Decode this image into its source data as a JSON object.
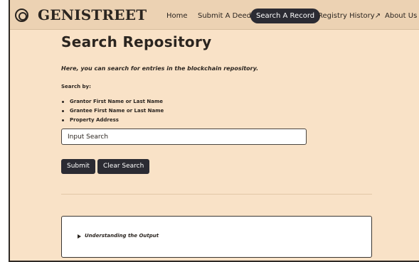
{
  "brand": {
    "name": "GENISTREET",
    "logo_icon": "concentric-circle-logo"
  },
  "nav": {
    "items": [
      {
        "label": "Home",
        "active": false
      },
      {
        "label": "Submit A Deed",
        "active": false
      },
      {
        "label": "Search A Record",
        "active": true
      },
      {
        "label": "Registry History",
        "active": false,
        "icon": "external-arrow-icon"
      },
      {
        "label": "About Us",
        "active": false
      }
    ],
    "external_arrow": "↗"
  },
  "page": {
    "title": "Search Repository",
    "intro": "Here, you can search for entries in the blockchain repository.",
    "search_by_label": "Search by:",
    "search_options": [
      "Grantor First Name or Last Name",
      "Grantee First Name or Last Name",
      "Property Address"
    ]
  },
  "search": {
    "value": "Input Search",
    "placeholder": "Input Search"
  },
  "buttons": {
    "submit": "Submit",
    "clear": "Clear Search"
  },
  "output": {
    "summary": "Understanding the Output"
  },
  "colors": {
    "page_background": "#f9e2c7",
    "navbar_background": "#ecd2b3",
    "dark_accent": "#2b2b33",
    "text": "#2b2520"
  }
}
